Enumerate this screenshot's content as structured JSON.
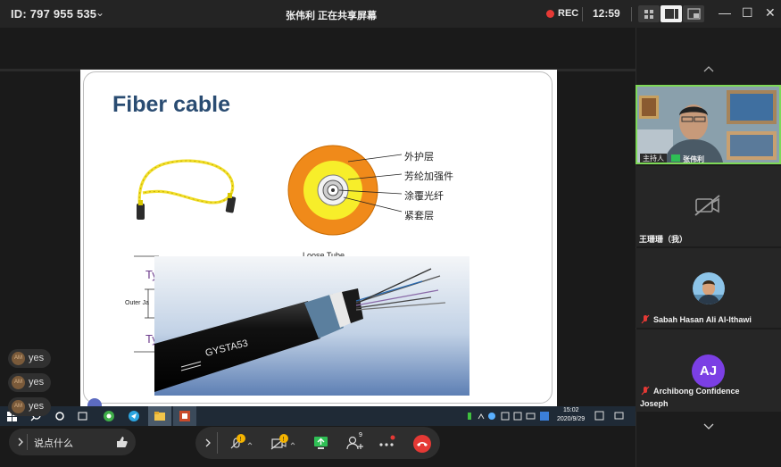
{
  "topbar": {
    "meeting_id": "ID: 797 955 535",
    "share_status": "张伟利 正在共享屏幕",
    "rec_label": "REC",
    "timer": "12:59",
    "minimize": "—",
    "maximize": "☐",
    "close": "✕"
  },
  "slide": {
    "title": "Fiber cable",
    "labels": [
      "外护层",
      "芳纶加强件",
      "涂覆光纤",
      "紧套层"
    ],
    "loose_tube_caption": "Loose Tube",
    "outer_jacket_label": "Outer Ja",
    "side_marker_1": "Ty",
    "side_marker_2": "Ty",
    "cable_print": "GYSTA53",
    "colors": {
      "title": "#2a4c72",
      "outer_ring": "#f08a1a",
      "inner_ring": "#f7ee2a"
    }
  },
  "taskbar": {
    "time": "15:02",
    "date": "2020/9/29"
  },
  "reactions": [
    {
      "avatar": "AM",
      "text": "yes"
    },
    {
      "avatar": "AM",
      "text": "yes"
    },
    {
      "avatar": "AM",
      "text": "yes"
    }
  ],
  "chat": {
    "placeholder": "说点什么",
    "expand_icon": "chevron-right-icon",
    "like_icon": "thumbs-up-icon"
  },
  "controls": {
    "participants_count": "9"
  },
  "panel": {
    "participants": [
      {
        "name": "张伟利",
        "role_badge": "主持人",
        "video": true
      },
      {
        "name": "王珊珊（我）",
        "video": false
      },
      {
        "name": "Sabah Hasan Ali Al-Ithawi",
        "avatar_type": "photo"
      },
      {
        "name_line1": "Archibong Confidence",
        "name_line2": "Joseph",
        "initials": "AJ"
      }
    ],
    "accent_initials": "#7b3fe4"
  }
}
